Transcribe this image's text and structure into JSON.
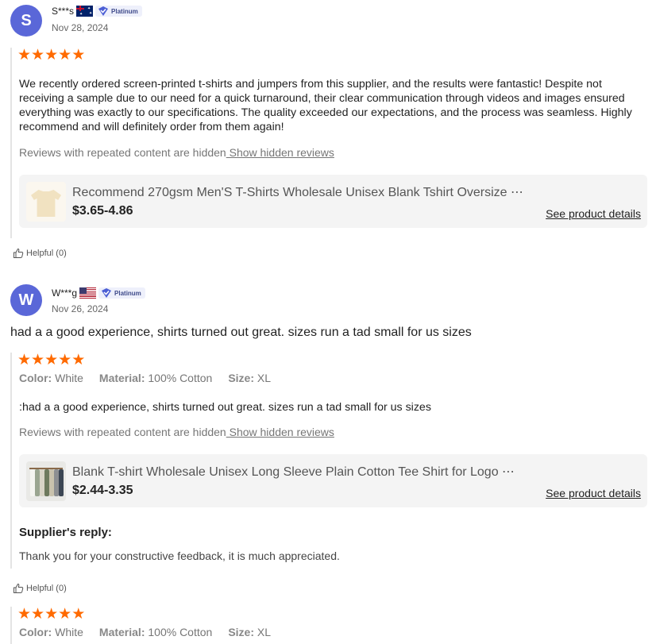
{
  "reviews": [
    {
      "avatar_letter": "S",
      "user": "S***s",
      "badge": "Platinum",
      "date": "Nov 28, 2024",
      "text": "We recently ordered screen-printed t-shirts and jumpers from this supplier, and the results were fantastic! Despite not receiving a sample due to our need for a quick turnaround, their clear communication through videos and images ensured everything was exactly to our specifications. The quality exceeded our expectations, and the process was seamless. Highly recommend and will definitely order from them again!",
      "hidden_note": "Reviews with repeated content are hidden",
      "hidden_link": " Show hidden reviews",
      "product_title": "Recommend 270gsm Men'S T-Shirts Wholesale Unisex Blank Tshirt Oversize ⋯",
      "product_price": "$3.65-4.86",
      "product_link": "See product details",
      "helpful": "Helpful (0)"
    },
    {
      "avatar_letter": "W",
      "user": "W***g",
      "badge": "Platinum",
      "date": "Nov 26, 2024",
      "headline": "had a a good experience, shirts turned out great. sizes run a tad small for us sizes",
      "attr_color_k": "Color:",
      "attr_color_v": "White",
      "attr_material_k": "Material:",
      "attr_material_v": "100% Cotton",
      "attr_size_k": "Size:",
      "attr_size_v": "XL",
      "text": ":had a a good experience, shirts turned out great. sizes run a tad small for us sizes",
      "hidden_note": "Reviews with repeated content are hidden",
      "hidden_link": " Show hidden reviews",
      "product_title": "Blank T-shirt Wholesale Unisex Long Sleeve Plain Cotton Tee Shirt for Logo ⋯",
      "product_price": "$2.44-3.35",
      "product_link": "See product details",
      "reply_title": "Supplier's reply:",
      "reply_text": "Thank you for your constructive feedback, it is much appreciated.",
      "helpful": "Helpful (0)"
    },
    {
      "attr_color_k": "Color:",
      "attr_color_v": "White",
      "attr_material_k": "Material:",
      "attr_material_v": "100% Cotton",
      "attr_size_k": "Size:",
      "attr_size_v": "XL"
    }
  ],
  "rating_stars": 5,
  "colors": {
    "star": "#ff6a00",
    "avatar": "#5a67d8",
    "card_bg": "#f4f4f4"
  }
}
